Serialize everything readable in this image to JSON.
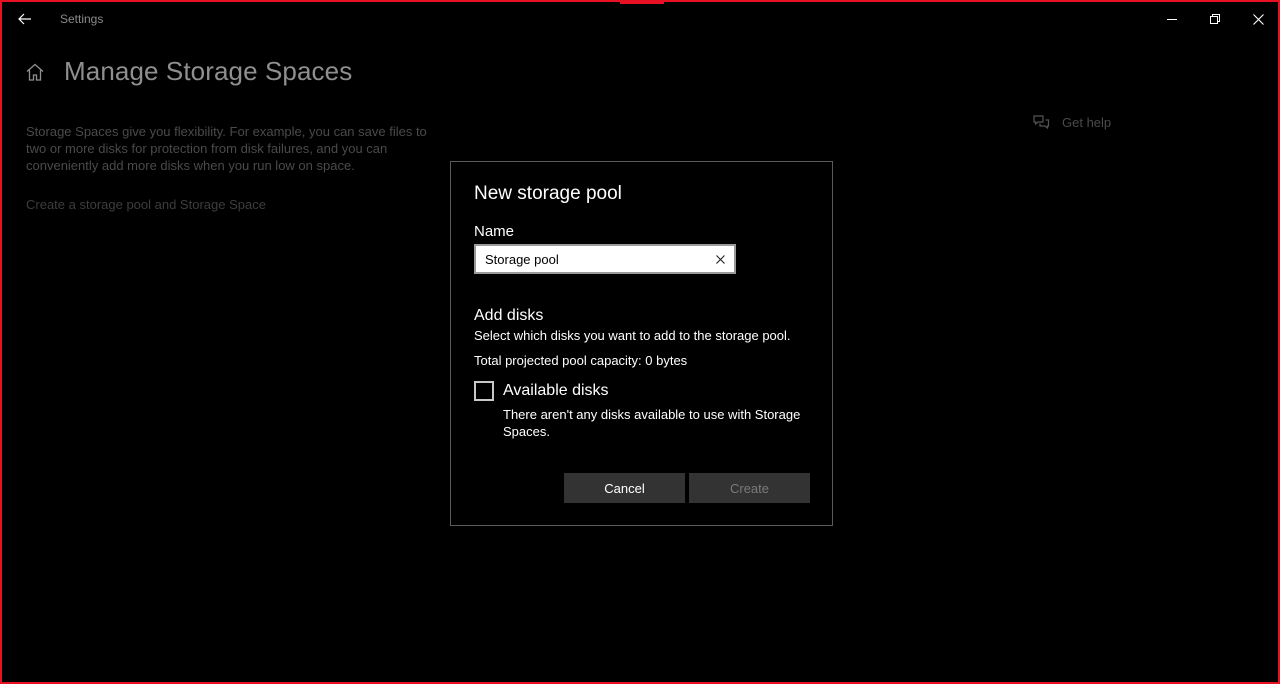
{
  "window": {
    "title": "Settings",
    "border_color": "#e81123",
    "icons": {
      "back": "back-arrow-icon",
      "minimize": "minimize-icon",
      "maximize": "restore-icon",
      "close": "close-icon"
    }
  },
  "page": {
    "title": "Manage Storage Spaces",
    "description": "Storage Spaces give you flexibility. For example, you can save files to two or more disks for protection from disk failures, and you can conveniently add more disks when you run low on space.",
    "link": "Create a storage pool and Storage Space",
    "help_label": "Get help",
    "icons": {
      "home": "home-icon",
      "help": "chat-help-icon"
    }
  },
  "dialog": {
    "title": "New storage pool",
    "name_label": "Name",
    "name_value": "Storage pool",
    "add_disks_title": "Add disks",
    "add_disks_desc": "Select which disks you want to add to the storage pool.",
    "capacity": "Total projected pool capacity: 0 bytes",
    "available_label": "Available disks",
    "available_checked": false,
    "available_note": "There aren't any disks available to use with Storage Spaces.",
    "cancel_label": "Cancel",
    "create_label": "Create",
    "create_enabled": false
  }
}
